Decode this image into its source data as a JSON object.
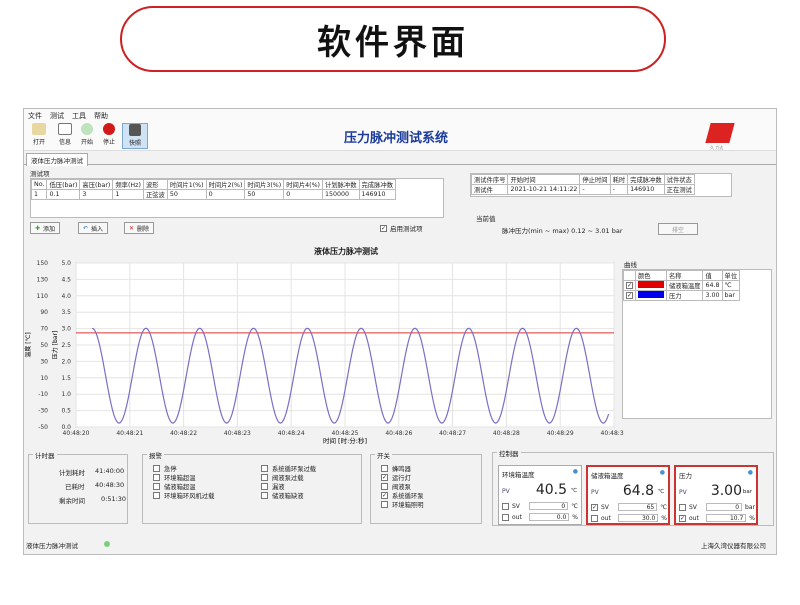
{
  "banner": {
    "title": "软件界面"
  },
  "menu": [
    "文件",
    "测试",
    "工具",
    "帮助"
  ],
  "toolbar": {
    "open": "打开",
    "info": "信息",
    "start": "开始",
    "stop": "停止",
    "snapshot": "快照"
  },
  "app_title": "压力脉冲测试系统",
  "logo_text": "久 力达",
  "tab": "液体压力脉冲测试",
  "test_items": {
    "label": "测试项",
    "headers": [
      "No.",
      "低压(bar)",
      "高压(bar)",
      "频率(Hz)",
      "波形",
      "时间片1(%)",
      "时间片2(%)",
      "时间片3(%)",
      "时间片4(%)",
      "计划脉冲数",
      "完成脉冲数"
    ],
    "rows": [
      [
        "1",
        "0.1",
        "3",
        "1",
        "正弦波",
        "50",
        "0",
        "50",
        "0",
        "150000",
        "146910"
      ]
    ]
  },
  "test_info": {
    "headers": [
      "测试件序号",
      "开始时间",
      "停止时间",
      "耗时",
      "完成脉冲数",
      "试件状态"
    ],
    "rows": [
      [
        "测试件",
        "2021-10-21 14:11:22",
        "-",
        "-",
        "146910",
        "正在测试"
      ]
    ]
  },
  "current": {
    "label": "当前值",
    "text": "脉冲压力(min ~ max)  0.12 ~ 3.01  bar"
  },
  "buttons": {
    "add": "添加",
    "insert": "插入",
    "delete": "删除",
    "enable": "启用测试项",
    "clear": "排空"
  },
  "chart_data": {
    "type": "line",
    "title": "液体压力脉冲测试",
    "xlabel": "时间 [时:分:秒]",
    "ylabel_left": "温度 [℃]",
    "ylabel_right": "压力 [bar]",
    "x_ticks": [
      "40:48:20",
      "40:48:21",
      "40:48:22",
      "40:48:23",
      "40:48:24",
      "40:48:25",
      "40:48:26",
      "40:48:27",
      "40:48:28",
      "40:48:29",
      "40:48:30"
    ],
    "y_left_ticks": [
      "150",
      "130",
      "110",
      "90",
      "70",
      "50",
      "30",
      "10",
      "-10",
      "-30",
      "-50"
    ],
    "y_right_ticks": [
      "5.0",
      "4.5",
      "4.0",
      "3.5",
      "3.0",
      "2.5",
      "2.0",
      "1.5",
      "1.0",
      "0.5",
      "0.0"
    ],
    "ylim_right": [
      0,
      5
    ],
    "xlim_seconds": [
      0,
      10
    ],
    "series": [
      {
        "name": "储液箱温度",
        "color": "#e03030",
        "constant": 64.8,
        "axis": "left"
      },
      {
        "name": "压力",
        "color": "#7a6fc6",
        "axis": "right",
        "min": 0.12,
        "max": 3.01,
        "frequency_hz": 1,
        "x_start": 0.3,
        "x_end": 9.9
      }
    ]
  },
  "curves": {
    "label": "曲线",
    "headers": [
      "颜色",
      "名称",
      "值",
      "单位"
    ],
    "rows": [
      {
        "color": "#e00000",
        "name": "储液箱温度",
        "value": "64.8",
        "unit": "℃"
      },
      {
        "color": "#0000ee",
        "name": "压力",
        "value": "3.00",
        "unit": "bar"
      }
    ]
  },
  "timer": {
    "label": "计时器",
    "planned_label": "计划耗时",
    "planned": "41:40:00",
    "used_label": "已耗时",
    "used": "40:48:30",
    "remain_label": "剩余时间",
    "remain": "0:51:30"
  },
  "alarms": {
    "label": "报警",
    "col1": [
      "急停",
      "环境箱超温",
      "储液箱超温",
      "环境箱环风机过载"
    ],
    "col2": [
      "系统循环泵过载",
      "阀液泵过载",
      "漏液",
      "储液箱缺液"
    ]
  },
  "switches": {
    "label": "开关",
    "items": [
      {
        "name": "蜂鸣器",
        "on": false
      },
      {
        "name": "运行灯",
        "on": true
      },
      {
        "name": "阀液泵",
        "on": false
      },
      {
        "name": "系统循环泵",
        "on": true
      },
      {
        "name": "环境箱照明",
        "on": false
      }
    ]
  },
  "controllers": {
    "label": "控制器",
    "items": [
      {
        "name": "环境箱温度",
        "pv": "40.5",
        "unit": "℃",
        "sv": "0",
        "sv_unit": "℃",
        "out": "0.0",
        "sv_checked": false,
        "out_checked": false,
        "highlight": false
      },
      {
        "name": "储液箱温度",
        "pv": "64.8",
        "unit": "℃",
        "sv": "65",
        "sv_unit": "℃",
        "out": "30.0",
        "sv_checked": true,
        "out_checked": false,
        "highlight": true
      },
      {
        "name": "压力",
        "pv": "3.00",
        "unit": "bar",
        "sv": "0",
        "sv_unit": "bar",
        "out": "10.7",
        "sv_checked": false,
        "out_checked": true,
        "highlight": true
      }
    ]
  },
  "status": {
    "left": "液体压力脉冲测试",
    "right": "上海久湾仪器有限公司"
  }
}
